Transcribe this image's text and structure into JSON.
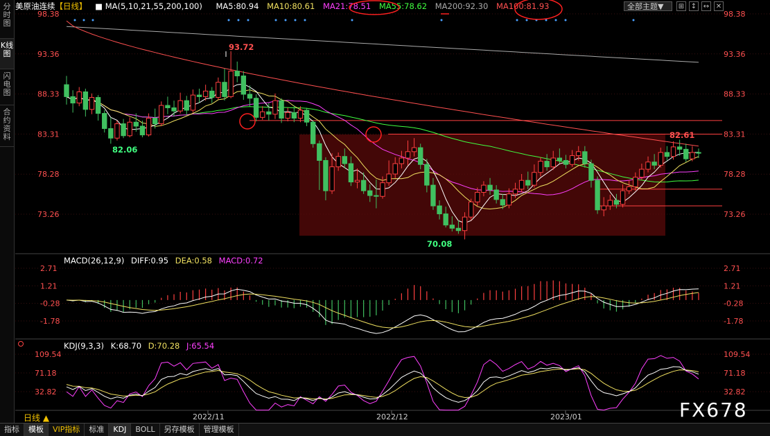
{
  "sidebar": {
    "tabs": [
      {
        "label": "分时图",
        "active": false
      },
      {
        "label": "K线图",
        "active": true
      },
      {
        "label": "闪电图",
        "active": false
      },
      {
        "label": "合约资料",
        "active": false
      }
    ]
  },
  "header": {
    "symbol": "美原油连续",
    "period": "【日线】",
    "ma_label": "MA(5,10,21,55,200,100)",
    "ma5": "MA5:80.94",
    "ma10": "MA10:80.61",
    "ma21": "MA21:78.51",
    "ma55": "MA55:78.62",
    "ma200": "MA200:92.30",
    "ma100": "MA100:81.93",
    "theme_button": "全部主题▼",
    "icon_buttons": [
      "⊞",
      "↕",
      "↔",
      "✕"
    ]
  },
  "colors": {
    "ma5": "#ffffff",
    "ma10": "#f0e060",
    "ma21": "#ff40ff",
    "ma55": "#40ff40",
    "ma200": "#aaaaaa",
    "ma100": "#ff5050",
    "up": "#ff4040",
    "down": "#40c060",
    "axis": "#ff5050"
  },
  "price_axis": {
    "ticks": [
      "98.38",
      "93.36",
      "88.33",
      "83.31",
      "78.28",
      "73.26"
    ]
  },
  "price_annotations": {
    "high": "93.72",
    "low1": "82.06",
    "low2": "70.08",
    "recent_high": "82.61"
  },
  "macd": {
    "label": "MACD(26,12,9)",
    "diff": "DIFF:0.95",
    "dea": "DEA:0.58",
    "macd": "MACD:0.72",
    "ticks": [
      "2.71",
      "1.21",
      "-0.28",
      "-1.78"
    ]
  },
  "kdj": {
    "label": "KDJ(9,3,3)",
    "k": "K:68.70",
    "d": "D:70.28",
    "j": "J:65.54",
    "ticks": [
      "109.54",
      "71.18",
      "32.82"
    ]
  },
  "x_axis": {
    "labels": [
      "2022/11",
      "2022/12",
      "2023/01"
    ]
  },
  "bottom_bar": {
    "day_line": "日线 ▲",
    "tabs": [
      {
        "label": "指标",
        "active": false,
        "vip": false
      },
      {
        "label": "模板",
        "active": true,
        "vip": false
      },
      {
        "label": "VIP指标",
        "active": false,
        "vip": true
      },
      {
        "label": "标准",
        "active": false,
        "vip": false
      },
      {
        "label": "KDJ",
        "active": true,
        "vip": false
      },
      {
        "label": "BOLL",
        "active": false,
        "vip": false
      },
      {
        "label": "另存模板",
        "active": false,
        "vip": false
      },
      {
        "label": "管理模板",
        "active": false,
        "vip": false
      }
    ]
  },
  "watermark": "FX678",
  "chart_data": {
    "type": "candlestick",
    "ylim": [
      70.0,
      98.6
    ],
    "candles": [
      [
        89.5,
        88.0,
        90.6,
        87.0
      ],
      [
        88.0,
        87.2,
        88.8,
        86.0
      ],
      [
        87.2,
        88.6,
        89.2,
        86.8
      ],
      [
        88.6,
        86.4,
        89.0,
        85.5
      ],
      [
        86.4,
        87.9,
        88.4,
        85.8
      ],
      [
        87.9,
        85.9,
        88.2,
        85.0
      ],
      [
        85.9,
        84.0,
        86.3,
        83.5
      ],
      [
        84.0,
        82.8,
        85.4,
        82.1
      ],
      [
        82.8,
        84.6,
        85.0,
        82.5
      ],
      [
        84.6,
        83.1,
        85.2,
        82.8
      ],
      [
        83.1,
        84.8,
        85.4,
        82.9
      ],
      [
        84.8,
        84.3,
        85.9,
        83.6
      ],
      [
        84.3,
        83.2,
        85.0,
        82.9
      ],
      [
        83.2,
        85.3,
        85.9,
        83.0
      ],
      [
        85.3,
        84.6,
        86.5,
        84.0
      ],
      [
        84.6,
        86.9,
        87.4,
        84.3
      ],
      [
        86.9,
        86.6,
        88.0,
        85.8
      ],
      [
        86.6,
        86.2,
        87.5,
        85.5
      ],
      [
        86.2,
        87.5,
        88.5,
        85.9
      ],
      [
        87.5,
        86.3,
        88.1,
        85.7
      ],
      [
        86.3,
        88.2,
        88.9,
        86.0
      ],
      [
        88.2,
        88.0,
        89.0,
        87.2
      ],
      [
        88.0,
        88.7,
        89.5,
        87.5
      ],
      [
        88.7,
        87.9,
        89.2,
        87.2
      ],
      [
        87.9,
        89.8,
        90.4,
        87.6
      ],
      [
        89.8,
        88.0,
        91.5,
        87.5
      ],
      [
        88.0,
        91.2,
        93.7,
        87.8
      ],
      [
        91.2,
        90.6,
        92.4,
        89.8
      ],
      [
        90.6,
        88.3,
        91.2,
        87.6
      ],
      [
        88.3,
        87.8,
        89.4,
        86.8
      ],
      [
        87.8,
        85.4,
        88.3,
        84.9
      ],
      [
        85.4,
        86.1,
        86.8,
        85.1
      ],
      [
        86.1,
        85.8,
        87.2,
        85.0
      ],
      [
        85.8,
        87.5,
        88.4,
        85.2
      ],
      [
        87.5,
        85.3,
        87.8,
        84.7
      ],
      [
        85.3,
        86.0,
        86.6,
        84.9
      ],
      [
        86.0,
        85.3,
        86.9,
        84.8
      ],
      [
        85.3,
        86.3,
        86.8,
        84.8
      ],
      [
        86.3,
        84.8,
        86.6,
        84.3
      ],
      [
        84.8,
        82.1,
        85.0,
        81.6
      ],
      [
        82.1,
        80.0,
        82.5,
        76.3
      ],
      [
        80.0,
        76.2,
        80.4,
        75.0
      ],
      [
        76.2,
        79.2,
        80.9,
        75.8
      ],
      [
        79.2,
        80.5,
        81.0,
        78.7
      ],
      [
        80.5,
        79.6,
        81.5,
        79.0
      ],
      [
        79.6,
        77.3,
        80.5,
        76.8
      ],
      [
        77.3,
        77.5,
        79.0,
        76.5
      ],
      [
        77.5,
        76.2,
        78.5,
        75.8
      ],
      [
        76.2,
        75.6,
        77.0,
        74.8
      ],
      [
        75.6,
        75.5,
        77.6,
        74.0
      ],
      [
        75.5,
        77.2,
        78.0,
        75.2
      ],
      [
        77.2,
        78.3,
        80.0,
        76.8
      ],
      [
        78.3,
        79.6,
        80.4,
        77.8
      ],
      [
        79.6,
        80.3,
        81.2,
        79.0
      ],
      [
        80.3,
        81.1,
        82.5,
        79.4
      ],
      [
        81.1,
        81.6,
        82.8,
        80.5
      ],
      [
        81.6,
        79.5,
        82.1,
        78.9
      ],
      [
        79.5,
        76.9,
        80.2,
        76.0
      ],
      [
        76.9,
        74.3,
        77.8,
        73.8
      ],
      [
        74.3,
        73.3,
        75.0,
        72.6
      ],
      [
        73.3,
        71.9,
        74.2,
        71.6
      ],
      [
        71.9,
        71.5,
        73.0,
        71.1
      ],
      [
        71.5,
        71.2,
        72.5,
        70.8
      ],
      [
        71.2,
        72.9,
        73.5,
        70.1
      ],
      [
        72.9,
        74.8,
        75.2,
        72.5
      ],
      [
        74.8,
        76.0,
        76.6,
        74.3
      ],
      [
        76.0,
        76.9,
        77.4,
        75.5
      ],
      [
        76.9,
        76.3,
        77.8,
        75.7
      ],
      [
        76.3,
        75.1,
        76.9,
        74.6
      ],
      [
        75.1,
        74.4,
        75.8,
        73.9
      ],
      [
        74.4,
        75.8,
        76.5,
        74.0
      ],
      [
        75.8,
        76.4,
        77.2,
        75.3
      ],
      [
        76.4,
        77.5,
        78.3,
        76.0
      ],
      [
        77.5,
        76.9,
        78.6,
        76.4
      ],
      [
        76.9,
        78.5,
        79.5,
        76.6
      ],
      [
        78.5,
        79.9,
        80.4,
        78.0
      ],
      [
        79.9,
        79.2,
        80.8,
        78.7
      ],
      [
        79.2,
        80.3,
        81.2,
        78.8
      ],
      [
        80.3,
        80.0,
        81.5,
        79.6
      ],
      [
        80.0,
        79.5,
        80.7,
        79.0
      ],
      [
        79.5,
        80.6,
        81.3,
        79.2
      ],
      [
        80.6,
        81.1,
        81.8,
        80.0
      ],
      [
        81.1,
        79.6,
        81.8,
        79.1
      ],
      [
        79.6,
        77.5,
        80.1,
        76.6
      ],
      [
        77.5,
        73.8,
        78.0,
        73.3
      ],
      [
        73.8,
        74.3,
        75.4,
        73.0
      ],
      [
        74.3,
        75.0,
        75.7,
        73.8
      ],
      [
        75.0,
        74.5,
        75.8,
        74.0
      ],
      [
        74.5,
        76.2,
        77.0,
        74.1
      ],
      [
        76.2,
        76.7,
        77.5,
        75.8
      ],
      [
        76.7,
        77.9,
        78.5,
        76.2
      ],
      [
        77.9,
        78.9,
        79.6,
        77.6
      ],
      [
        78.9,
        79.8,
        80.5,
        78.5
      ],
      [
        79.8,
        79.4,
        80.8,
        78.9
      ],
      [
        79.4,
        81.0,
        81.6,
        79.1
      ],
      [
        81.0,
        80.5,
        81.8,
        80.0
      ],
      [
        80.5,
        81.7,
        82.4,
        80.1
      ],
      [
        81.7,
        81.4,
        82.6,
        80.6
      ],
      [
        81.4,
        80.2,
        82.1,
        79.8
      ],
      [
        80.2,
        81.0,
        81.8,
        79.9
      ],
      [
        81.0,
        80.9,
        81.5,
        80.3
      ]
    ]
  }
}
